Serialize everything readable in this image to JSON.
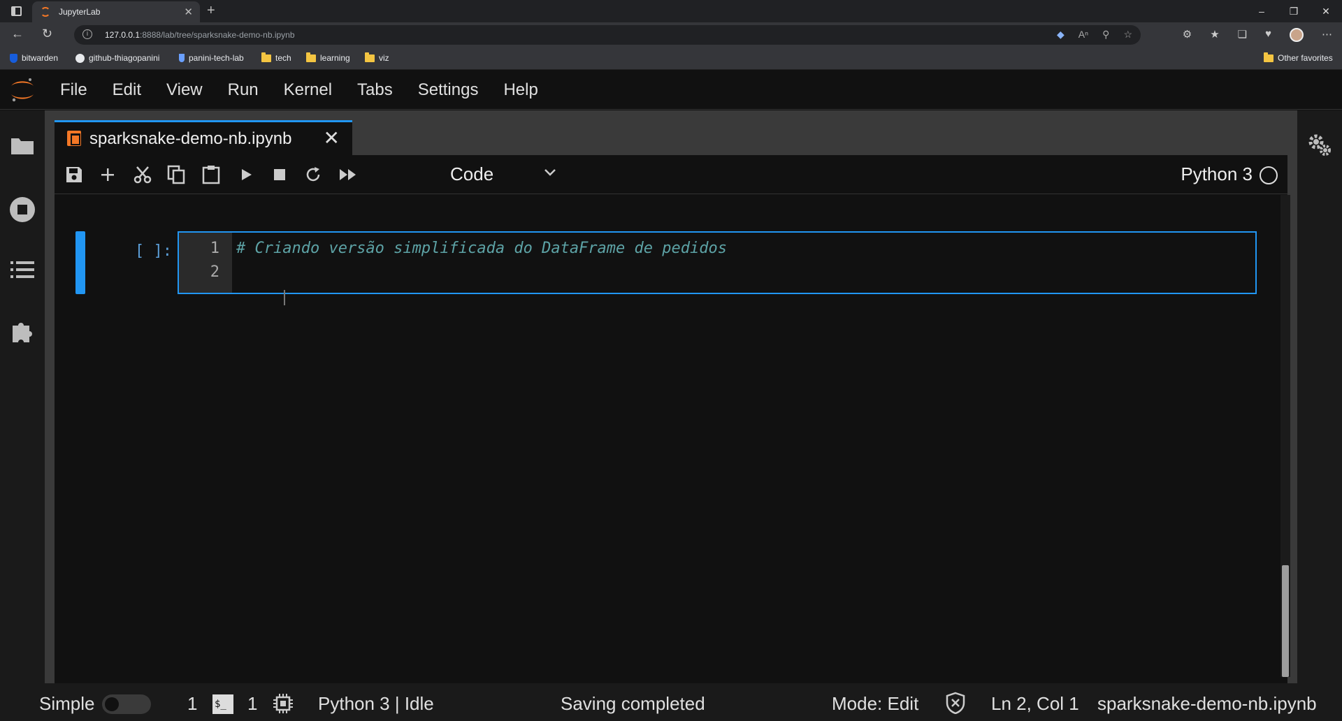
{
  "browser": {
    "tab_title": "JupyterLab",
    "tab_close": "✕",
    "new_tab": "+",
    "url_host": "127.0.0.1",
    "url_rest": ":8888/lab/tree/sparksnake-demo-nb.ipynb",
    "bookmarks": [
      {
        "label": "bitwarden",
        "icon": "shield-icon"
      },
      {
        "label": "github-thiagopanini",
        "icon": "github-icon"
      },
      {
        "label": "panini-tech-lab",
        "icon": "flask-icon"
      },
      {
        "label": "tech",
        "icon": "folder-icon"
      },
      {
        "label": "learning",
        "icon": "folder-icon"
      },
      {
        "label": "viz",
        "icon": "folder-icon"
      }
    ],
    "other_favorites": "Other favorites"
  },
  "menu": [
    "File",
    "Edit",
    "View",
    "Run",
    "Kernel",
    "Tabs",
    "Settings",
    "Help"
  ],
  "document_tab": {
    "title": "sparksnake-demo-nb.ipynb",
    "close": "✕"
  },
  "toolbar": {
    "cell_type": "Code",
    "kernel_name": "Python 3"
  },
  "cell": {
    "prompt": "[ ]:",
    "lines": [
      {
        "number": "1",
        "code": "# Criando versão simplificada do DataFrame de pedidos"
      },
      {
        "number": "2",
        "code": ""
      }
    ]
  },
  "statusbar": {
    "mode_label": "Simple",
    "terminals_count": "1",
    "kernels_count": "1",
    "kernel_status": "Python 3 | Idle",
    "save_status": "Saving completed",
    "mode": "Mode: Edit",
    "position": "Ln 2, Col 1",
    "filename": "sparksnake-demo-nb.ipynb"
  },
  "colors": {
    "accent": "#2196f3",
    "jupyter_orange": "#f37726",
    "comment": "#5da3a6"
  }
}
